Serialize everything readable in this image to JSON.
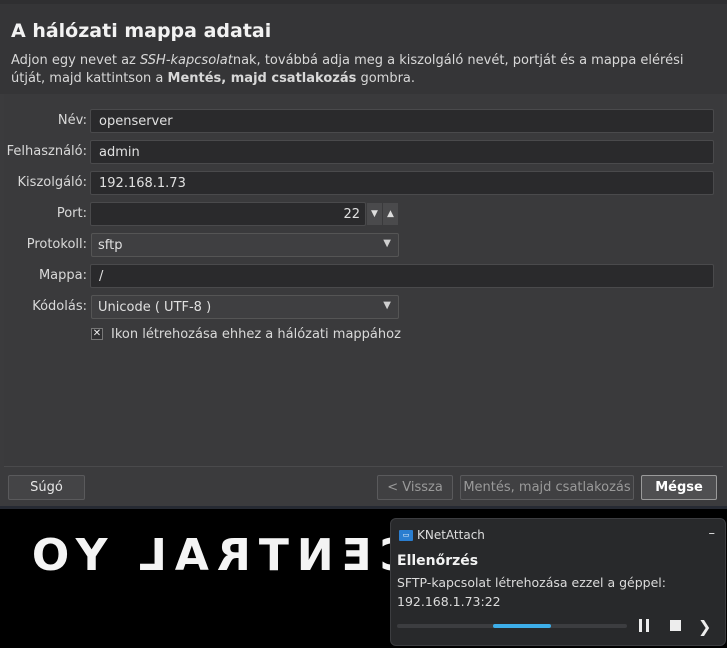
{
  "dialog": {
    "title": "A hálózati mappa adatai",
    "description": {
      "part1": "Adjon egy nevet az ",
      "part2_italic": "SSH-kapcsolat",
      "part3": "nak, továbbá adja meg a kiszolgáló nevét, portját és a mappa elérési útját, majd kattintson a ",
      "part4_bold": "Mentés, majd csatlakozás",
      "part5": " gombra."
    },
    "fields": {
      "name_label": "Név:",
      "name_value": "openserver",
      "user_label": "Felhasználó:",
      "user_value": "admin",
      "server_label": "Kiszolgáló:",
      "server_value": "192.168.1.73",
      "port_label": "Port:",
      "port_value": "22",
      "protocol_label": "Protokoll:",
      "protocol_value": "sftp",
      "folder_label": "Mappa:",
      "folder_value": "/",
      "encoding_label": "Kódolás:",
      "encoding_value": "Unicode ( UTF-8 )"
    },
    "checkbox": {
      "checked": true,
      "mark": "✕",
      "label": "Ikon létrehozása ehhez a hálózati mappához"
    },
    "buttons": {
      "help": "Súgó",
      "back": "< Vissza",
      "save_connect": "Mentés, majd csatlakozás",
      "cancel": "Mégse"
    }
  },
  "wallpaper": {
    "text": "CENTRAL YO"
  },
  "notification": {
    "app_name": "KNetAttach",
    "title": "Ellenőrzés",
    "body": "SFTP-kapcsolat létrehozása ezzel a géppel: 192.168.1.73:22",
    "close": "–",
    "progress_state": "indeterminate",
    "accent": "#3daee9"
  },
  "colors": {
    "dialog_bg": "#3b3b3d",
    "field_bg": "#2a2a2c",
    "accent": "#3daee9"
  }
}
